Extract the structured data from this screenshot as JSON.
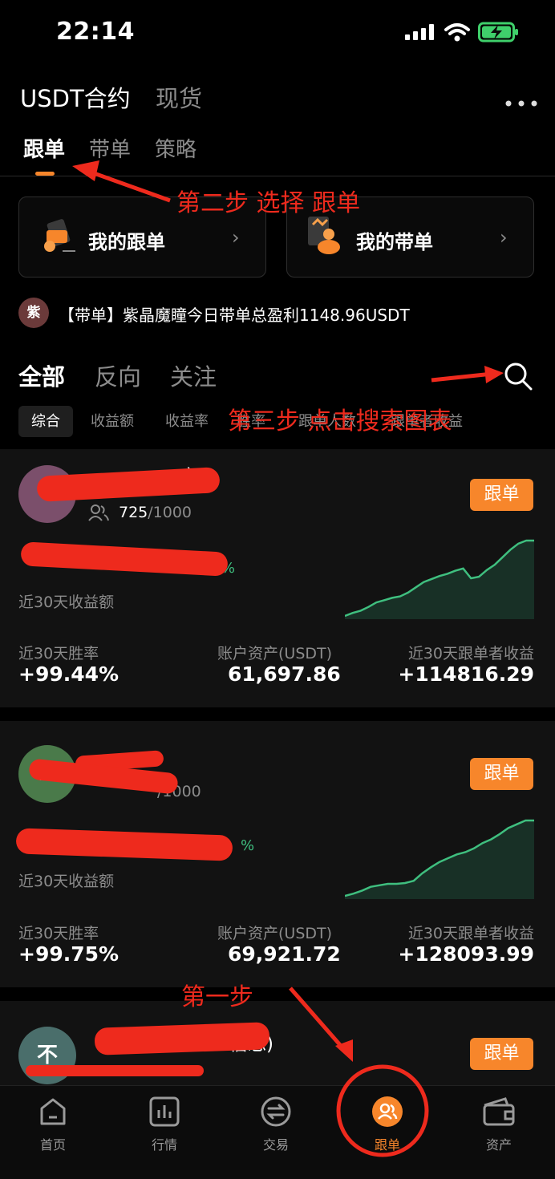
{
  "status": {
    "time": "22:14"
  },
  "header": {
    "tabs": [
      "USDT合约",
      "现货"
    ]
  },
  "subtabs": [
    "跟单",
    "带单",
    "策略"
  ],
  "cards": [
    {
      "label": "我的跟单"
    },
    {
      "label": "我的带单"
    }
  ],
  "announcement": {
    "avatar": "紫",
    "text": "【带单】紫晶魔瞳今日带单总盈利1148.96USDT"
  },
  "filters": [
    "全部",
    "反向",
    "关注"
  ],
  "sort_options": [
    "综合",
    "收益额",
    "收益率",
    "胜率",
    "跟单人数",
    "跟单者收益"
  ],
  "traders": [
    {
      "avatar_letter": "",
      "avatar_color": "#7b4f6b",
      "name_suffix": ")",
      "followers": "725",
      "max_followers": "/1000",
      "pnl_percent": "78%",
      "pnl_label": "近30天收益额",
      "follow_label": "跟单",
      "stats": [
        {
          "label": "近30天胜率",
          "value": "+99.44%"
        },
        {
          "label": "账户资产(USDT)",
          "value": "61,697.86"
        },
        {
          "label": "近30天跟单者收益",
          "value": "+114816.29"
        }
      ],
      "curve": [
        0.0,
        0.04,
        0.07,
        0.12,
        0.18,
        0.21,
        0.24,
        0.26,
        0.31,
        0.38,
        0.45,
        0.49,
        0.53,
        0.56,
        0.6,
        0.63,
        0.5,
        0.52,
        0.61,
        0.68,
        0.78,
        0.88,
        0.96,
        1.0,
        1.0
      ]
    },
    {
      "avatar_letter": "W",
      "avatar_color": "#4a7a4a",
      "name_suffix": "",
      "followers": "",
      "max_followers": "/1000",
      "pnl_percent": "%",
      "pnl_label": "近30天收益额",
      "follow_label": "跟单",
      "stats": [
        {
          "label": "近30天胜率",
          "value": "+99.75%"
        },
        {
          "label": "账户资产(USDT)",
          "value": "69,921.72"
        },
        {
          "label": "近30天跟单者收益",
          "value": "+128093.99"
        }
      ],
      "curve": [
        0.0,
        0.03,
        0.07,
        0.12,
        0.14,
        0.16,
        0.16,
        0.17,
        0.2,
        0.3,
        0.38,
        0.45,
        0.5,
        0.55,
        0.58,
        0.63,
        0.7,
        0.75,
        0.82,
        0.9,
        0.95,
        1.0,
        1.0
      ]
    },
    {
      "avatar_letter": "不",
      "avatar_color": "#4a6e6b",
      "name_suffix": "信念)",
      "follow_label": "跟单"
    }
  ],
  "annotations": {
    "step1": "第一步",
    "step2": "第二步 选择 跟单",
    "step3": "第三步 点击搜索图表"
  },
  "tabbar": [
    {
      "label": "首页",
      "icon": "home-icon"
    },
    {
      "label": "行情",
      "icon": "chart-icon"
    },
    {
      "label": "交易",
      "icon": "swap-icon"
    },
    {
      "label": "跟单",
      "icon": "copy-trade-icon",
      "active": true
    },
    {
      "label": "资产",
      "icon": "wallet-icon"
    }
  ],
  "colors": {
    "accent": "#f7862b",
    "positive": "#3fbf7f",
    "annotation": "#ee2a1d"
  }
}
